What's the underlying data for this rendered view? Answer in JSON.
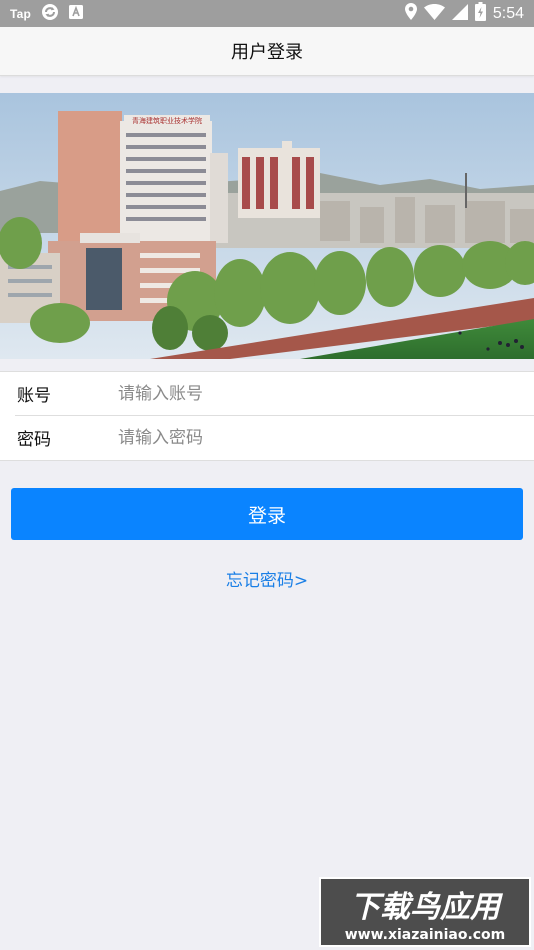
{
  "status_bar": {
    "app_label": "Tap",
    "time": "5:54",
    "icons": [
      "sync-icon",
      "a-notification-icon",
      "location-icon",
      "wifi-icon",
      "cellular-icon",
      "battery-charging-icon"
    ]
  },
  "header": {
    "title": "用户登录"
  },
  "banner": {
    "alt": "campus photo",
    "sign_text": "青海建筑职业技术学院"
  },
  "form": {
    "account": {
      "label": "账号",
      "placeholder": "请输入账号",
      "value": ""
    },
    "password": {
      "label": "密码",
      "placeholder": "请输入密码",
      "value": ""
    }
  },
  "login_button": {
    "label": "登录"
  },
  "forgot_link": {
    "label": "忘记密码>"
  },
  "watermark": {
    "line1": "下载鸟应用",
    "line2": "www.xiazainiao.com"
  },
  "colors": {
    "accent": "#0a84ff",
    "link": "#1a7fe6",
    "background": "#efeff4"
  }
}
